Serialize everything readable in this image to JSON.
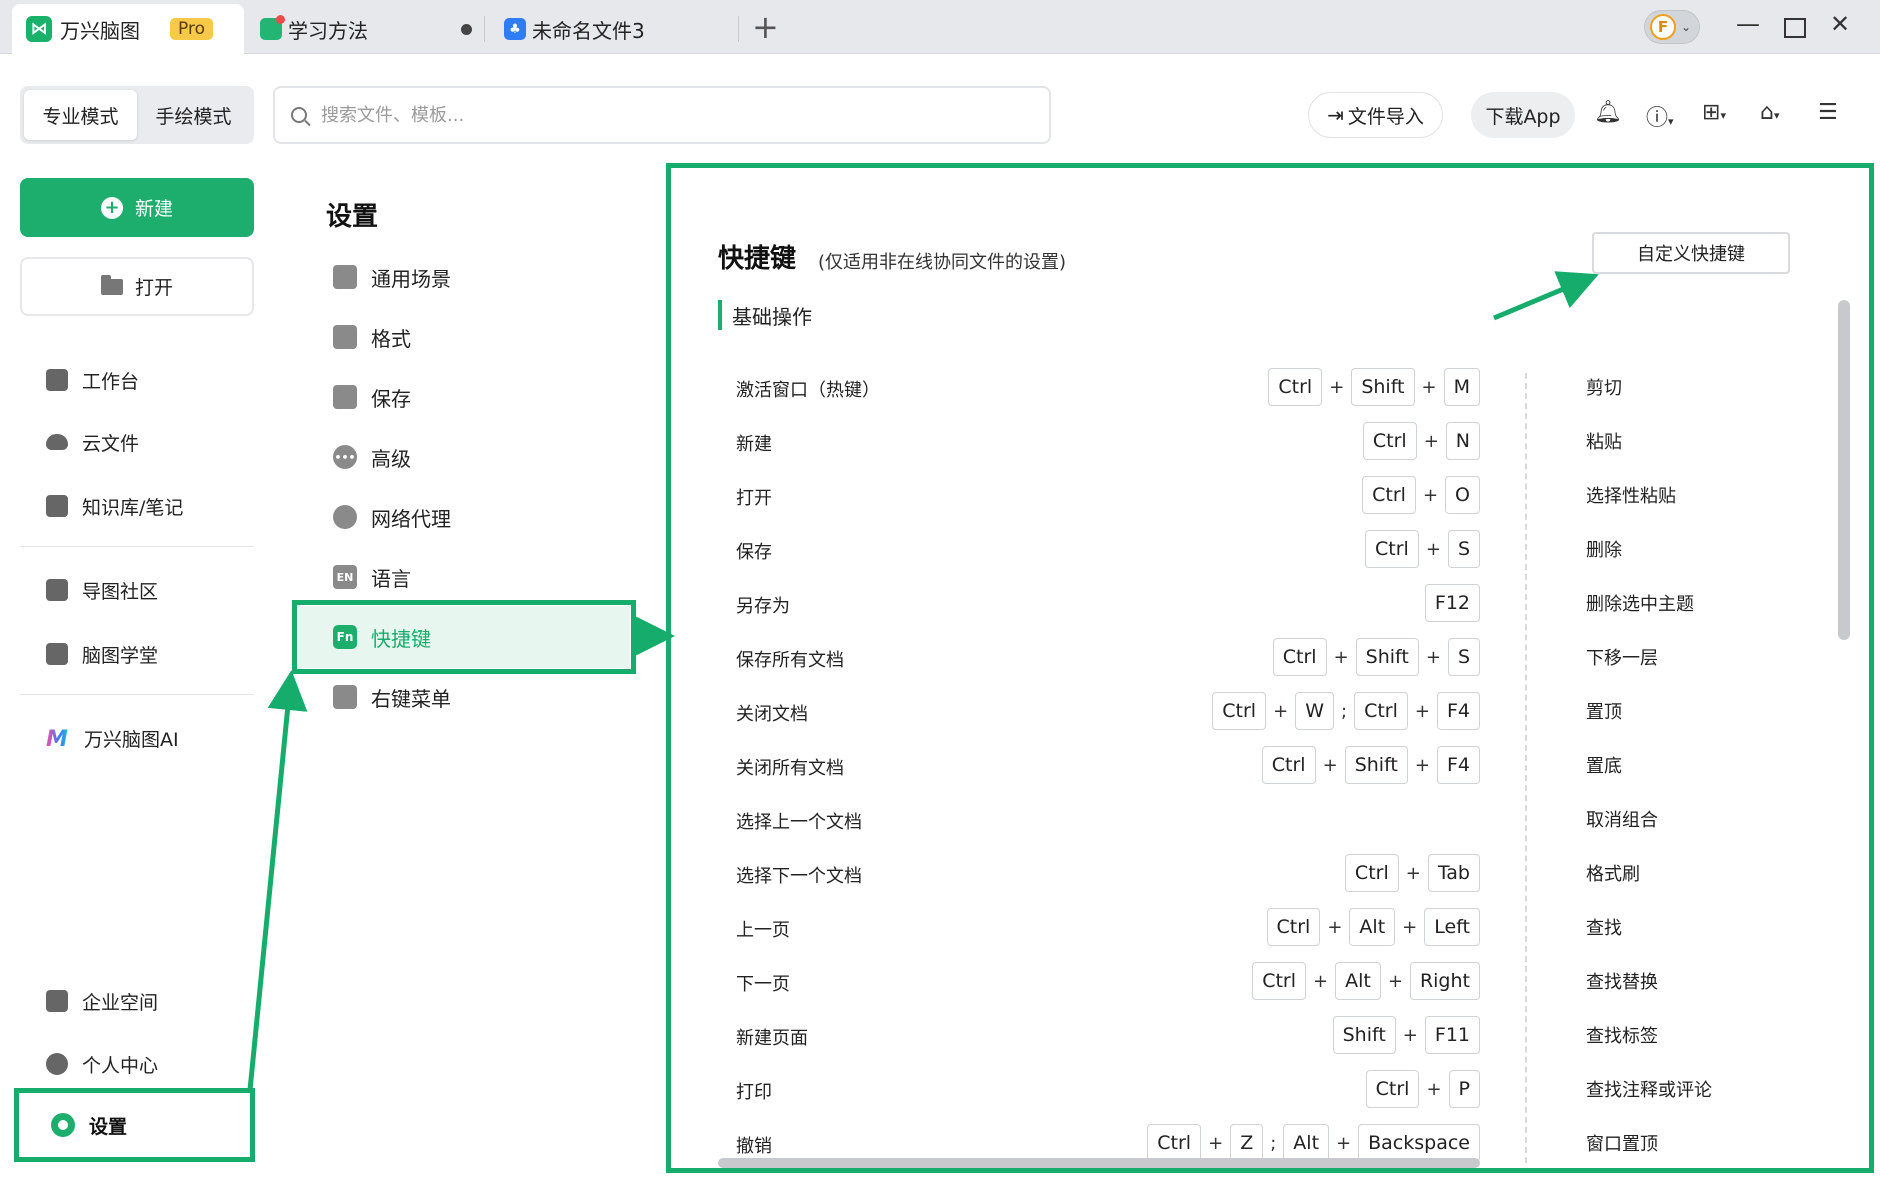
{
  "tabs": [
    {
      "title": "万兴脑图",
      "badge": "Pro"
    },
    {
      "title": "学习方法"
    },
    {
      "title": "未命名文件3"
    }
  ],
  "window": {
    "avatar_letter": "F"
  },
  "toolbar": {
    "modes": [
      "专业模式",
      "手绘模式"
    ],
    "search_placeholder": "搜索文件、模板...",
    "import_label": "文件导入",
    "download_label": "下载App"
  },
  "sidebar": {
    "new_label": "新建",
    "open_label": "打开",
    "items": [
      "工作台",
      "云文件",
      "知识库/笔记",
      "导图社区",
      "脑图学堂",
      "万兴脑图AI",
      "企业空间",
      "个人中心",
      "设置"
    ]
  },
  "settings": {
    "title": "设置",
    "items": [
      "通用场景",
      "格式",
      "保存",
      "高级",
      "网络代理",
      "语言",
      "快捷键",
      "右键菜单"
    ],
    "icon_en": "EN",
    "icon_fn": "Fn"
  },
  "shortcuts": {
    "title": "快捷键",
    "note": "(仅适用非在线协同文件的设置)",
    "custom_button": "自定义快捷键",
    "section": "基础操作",
    "rows": [
      {
        "label": "激活窗口（热键）",
        "keys": [
          "Ctrl",
          "+",
          "Shift",
          "+",
          "M"
        ]
      },
      {
        "label": "新建",
        "keys": [
          "Ctrl",
          "+",
          "N"
        ]
      },
      {
        "label": "打开",
        "keys": [
          "Ctrl",
          "+",
          "O"
        ]
      },
      {
        "label": "保存",
        "keys": [
          "Ctrl",
          "+",
          "S"
        ]
      },
      {
        "label": "另存为",
        "keys": [
          "F12"
        ]
      },
      {
        "label": "保存所有文档",
        "keys": [
          "Ctrl",
          "+",
          "Shift",
          "+",
          "S"
        ]
      },
      {
        "label": "关闭文档",
        "keys": [
          "Ctrl",
          "+",
          "W",
          ";",
          "Ctrl",
          "+",
          "F4"
        ]
      },
      {
        "label": "关闭所有文档",
        "keys": [
          "Ctrl",
          "+",
          "Shift",
          "+",
          "F4"
        ]
      },
      {
        "label": "选择上一个文档",
        "keys": []
      },
      {
        "label": "选择下一个文档",
        "keys": [
          "Ctrl",
          "+",
          "Tab"
        ]
      },
      {
        "label": "上一页",
        "keys": [
          "Ctrl",
          "+",
          "Alt",
          "+",
          "Left"
        ]
      },
      {
        "label": "下一页",
        "keys": [
          "Ctrl",
          "+",
          "Alt",
          "+",
          "Right"
        ]
      },
      {
        "label": "新建页面",
        "keys": [
          "Shift",
          "+",
          "F11"
        ]
      },
      {
        "label": "打印",
        "keys": [
          "Ctrl",
          "+",
          "P"
        ]
      },
      {
        "label": "撤销",
        "keys": [
          "Ctrl",
          "+",
          "Z",
          ";",
          "Alt",
          "+",
          "Backspace"
        ]
      }
    ],
    "right_col": [
      "剪切",
      "粘贴",
      "选择性粘贴",
      "删除",
      "删除选中主题",
      "下移一层",
      "置顶",
      "置底",
      "取消组合",
      "格式刷",
      "查找",
      "查找替换",
      "查找标签",
      "查找注释或评论",
      "窗口置顶"
    ]
  }
}
